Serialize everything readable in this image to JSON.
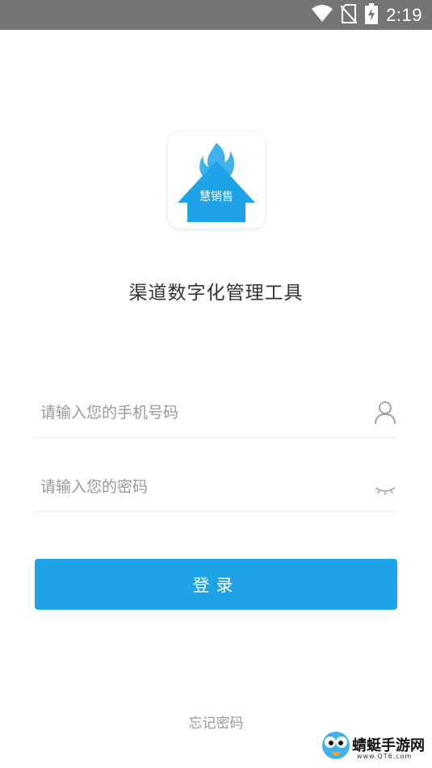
{
  "status_bar": {
    "time": "2:19",
    "icons": [
      "wifi-icon",
      "no-sim-icon",
      "battery-charging-icon"
    ]
  },
  "logo": {
    "text": "慧销售",
    "colors": {
      "flame": "#3fb1ec",
      "arrow": "#1fa3e8"
    }
  },
  "tagline": "渠道数字化管理工具",
  "phone_field": {
    "placeholder": "请输入您的手机号码",
    "value": "",
    "icon": "user-icon"
  },
  "password_field": {
    "placeholder": "请输入您的密码",
    "value": "",
    "icon": "eye-closed-icon"
  },
  "login_button": {
    "label": "登录"
  },
  "forgot_link": "忘记密码",
  "watermark": {
    "text": "蜻蜓手游网",
    "url": "www.QT6.com"
  },
  "colors": {
    "accent": "#1fa3e8",
    "status_bar": "#757575"
  }
}
